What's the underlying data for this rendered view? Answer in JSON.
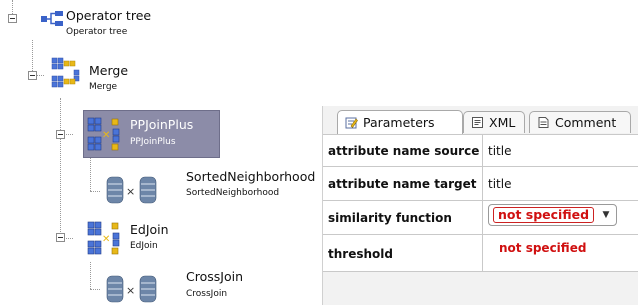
{
  "tree": {
    "root": {
      "title": "Operator tree",
      "subtitle": "Operator tree"
    },
    "merge": {
      "title": "Merge",
      "subtitle": "Merge"
    },
    "ppjoin": {
      "title": "PPJoinPlus",
      "subtitle": "PPJoinPlus"
    },
    "sorted": {
      "title": "SortedNeighborhood",
      "subtitle": "SortedNeighborhood"
    },
    "edjoin": {
      "title": "EdJoin",
      "subtitle": "EdJoin"
    },
    "cross": {
      "title": "CrossJoin",
      "subtitle": "CrossJoin"
    }
  },
  "panel": {
    "tabs": [
      {
        "label": "Parameters",
        "icon": "edit-icon",
        "active": true
      },
      {
        "label": "XML",
        "icon": "xml-icon",
        "active": false
      },
      {
        "label": "Comment",
        "icon": "comment-icon",
        "active": false
      }
    ],
    "rows": [
      {
        "label": "attribute name source",
        "value": "title"
      },
      {
        "label": "attribute name target",
        "value": "title"
      },
      {
        "label": "similarity function",
        "value": "not specified"
      },
      {
        "label": "threshold",
        "value": "not specified"
      }
    ]
  },
  "colors": {
    "selection": "#8c8ca8",
    "warning": "#d01010",
    "icon_blue": "#3a62c8",
    "icon_yellow": "#e8b818"
  }
}
